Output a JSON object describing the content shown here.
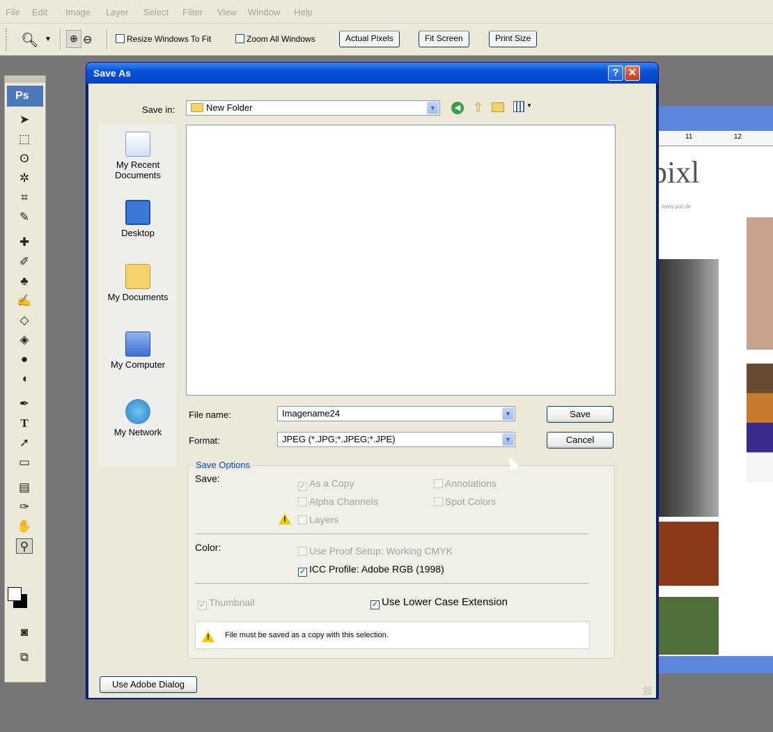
{
  "menubar": {
    "items": [
      "File",
      "Edit",
      "Image",
      "Layer",
      "Select",
      "Filter",
      "View",
      "Window",
      "Help"
    ]
  },
  "optionsbar": {
    "resize_windows": "Resize Windows To Fit",
    "zoom_all": "Zoom All Windows",
    "actual_pixels": "Actual Pixels",
    "fit_screen": "Fit Screen",
    "print_size": "Print Size"
  },
  "tools": {
    "logo": "Ps"
  },
  "dialog": {
    "title": "Save As",
    "help_btn": "?",
    "close_btn": "✕",
    "save_in_label": "Save in:",
    "save_in_value": "New Folder",
    "places": [
      "My Recent Documents",
      "Desktop",
      "My Documents",
      "My Computer",
      "My Network"
    ],
    "file_name_label": "File name:",
    "file_name_value": "Imagename24",
    "format_label": "Format:",
    "format_value": "JPEG (*.JPG;*.JPEG;*.JPE)",
    "save_button": "Save",
    "cancel_button": "Cancel",
    "save_options": {
      "title": "Save Options",
      "save_label": "Save:",
      "as_copy": "As a Copy",
      "annotations": "Annotations",
      "alpha_channels": "Alpha Channels",
      "spot_colors": "Spot Colors",
      "layers": "Layers",
      "color_label": "Color:",
      "proof_setup": "Use Proof Setup:  Working CMYK",
      "icc_profile": "ICC Profile:  Adobe RGB (1998)",
      "thumbnail": "Thumbnail",
      "lower_case": "Use Lower Case Extension",
      "warning": "File must be saved as a copy with this selection."
    },
    "adobe_dialog_button": "Use Adobe Dialog"
  },
  "document": {
    "ruler_11": "11",
    "ruler_12": "12",
    "logo_text": "pixl",
    "url_text": "www.pixl.de"
  },
  "colors": {
    "titlebar": "#0752d8",
    "dialog_bg": "#ece9d8",
    "group_title": "#0046d5"
  }
}
